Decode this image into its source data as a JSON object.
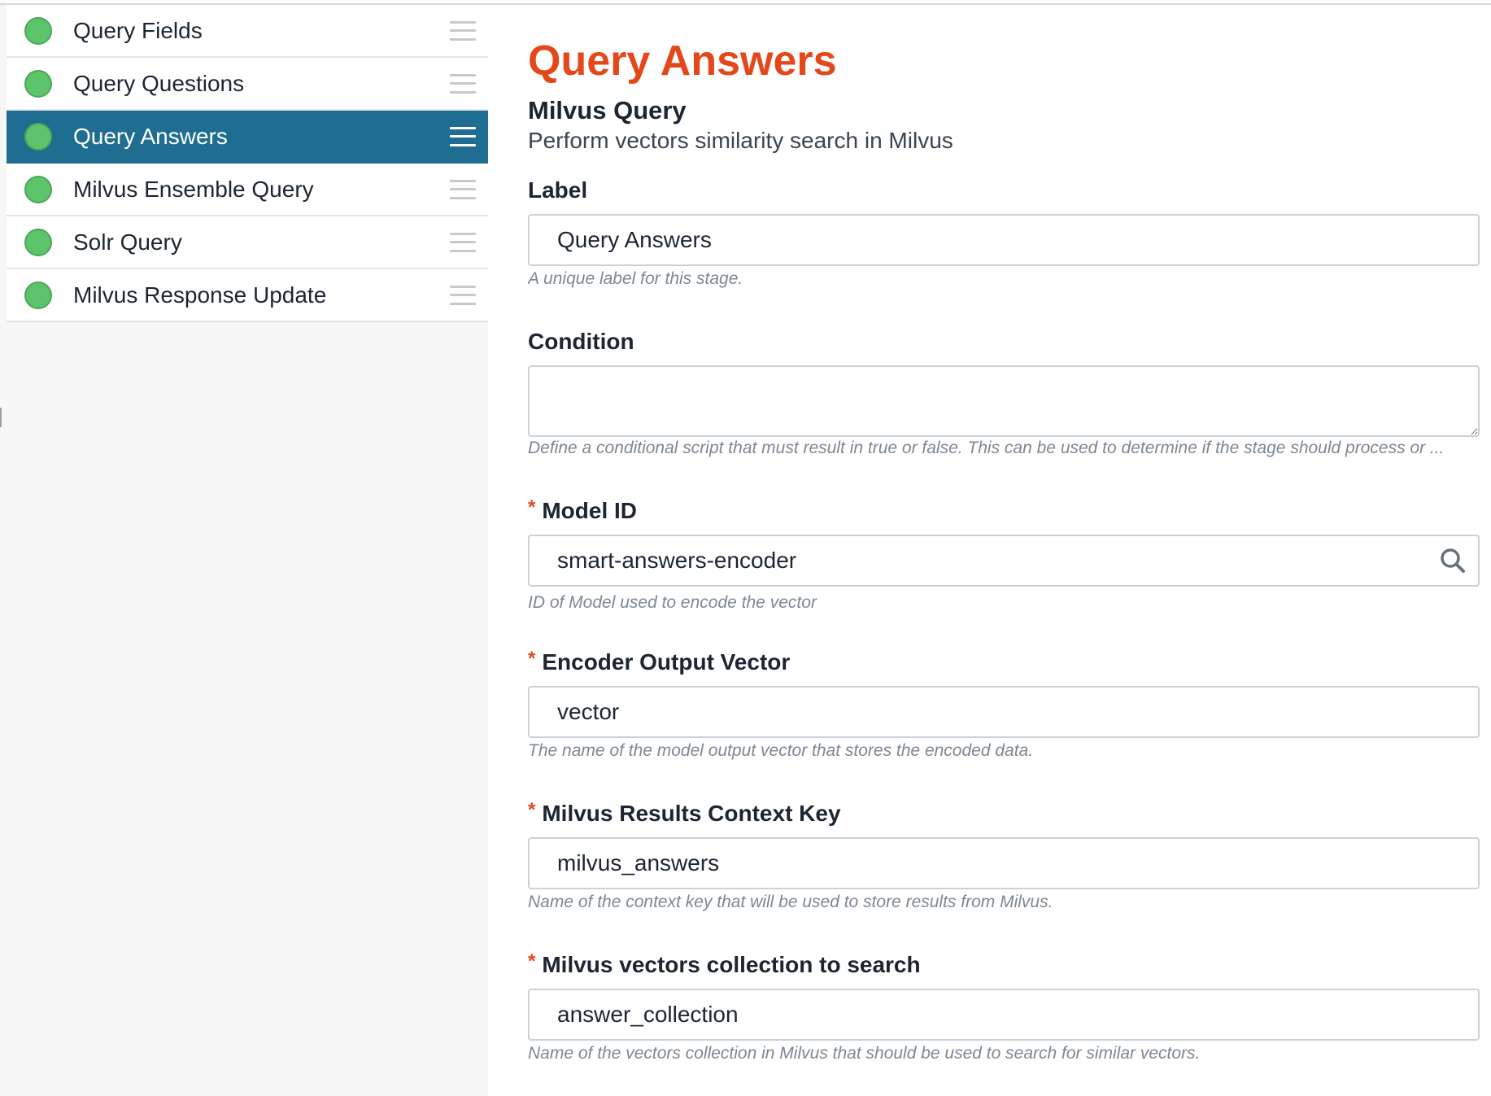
{
  "sidebar": {
    "stages": [
      {
        "label": "Query Fields",
        "active": false
      },
      {
        "label": "Query Questions",
        "active": false
      },
      {
        "label": "Query Answers",
        "active": true
      },
      {
        "label": "Milvus Ensemble Query",
        "active": false
      },
      {
        "label": "Solr Query",
        "active": false
      },
      {
        "label": "Milvus Response Update",
        "active": false
      }
    ]
  },
  "main": {
    "title": "Query Answers",
    "stage_type": "Milvus Query",
    "stage_description": "Perform vectors similarity search in Milvus",
    "fields": {
      "label": {
        "label": "Label",
        "value": "Query Answers",
        "help": "A unique label for this stage."
      },
      "condition": {
        "label": "Condition",
        "value": "",
        "help": "Define a conditional script that must result in true or false. This can be used to determine if the stage should process or ..."
      },
      "model_id": {
        "required_mark": "*",
        "label": "Model ID",
        "value": "smart-answers-encoder",
        "help": "ID of Model used to encode the vector"
      },
      "encoder_output_vector": {
        "required_mark": "*",
        "label": "Encoder Output Vector",
        "value": "vector",
        "help": "The name of the model output vector that stores the encoded data."
      },
      "milvus_results_context_key": {
        "required_mark": "*",
        "label": "Milvus Results Context Key",
        "value": "milvus_answers",
        "help": "Name of the context key that will be used to store results from Milvus."
      },
      "milvus_collection": {
        "required_mark": "*",
        "label": "Milvus vectors collection to search",
        "value": "answer_collection",
        "help": "Name of the vectors collection in Milvus that should be used to search for similar vectors."
      }
    }
  },
  "colors": {
    "title_accent": "#e4471a",
    "active_stage_bg": "#1f6e91",
    "status_ok": "#5ec46b"
  }
}
